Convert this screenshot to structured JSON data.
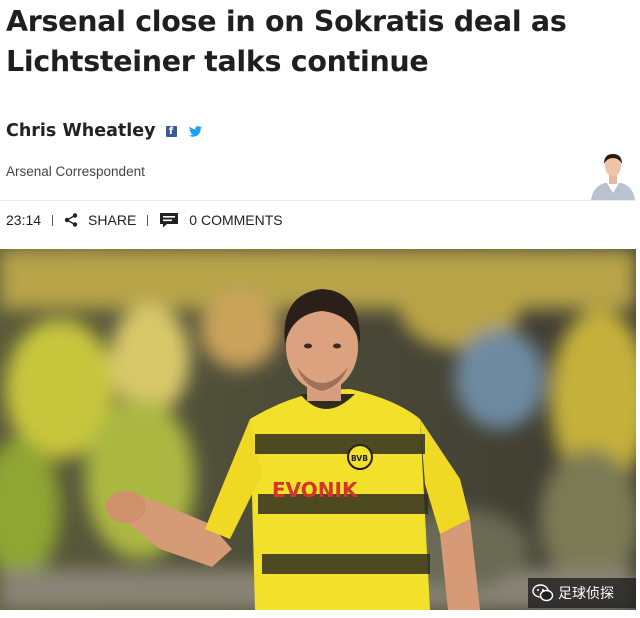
{
  "article": {
    "headline": "Arsenal close in on Sokratis deal as Lichtsteiner talks continue",
    "author": "Chris Wheatley",
    "role": "Arsenal Correspondent",
    "time": "23:14",
    "share_label": "SHARE",
    "comments_label": "0 COMMENTS"
  },
  "social": {
    "facebook_glyph": "f"
  },
  "photo": {
    "shirt_brand": "EVONIK",
    "club_crest": "BVB"
  },
  "watermark": {
    "text": "足球侦探"
  },
  "colors": {
    "facebook": "#3b5998",
    "twitter": "#1da1f2",
    "shirt_yellow": "#f3e02a",
    "stripe_dark": "#2f2e1e"
  }
}
